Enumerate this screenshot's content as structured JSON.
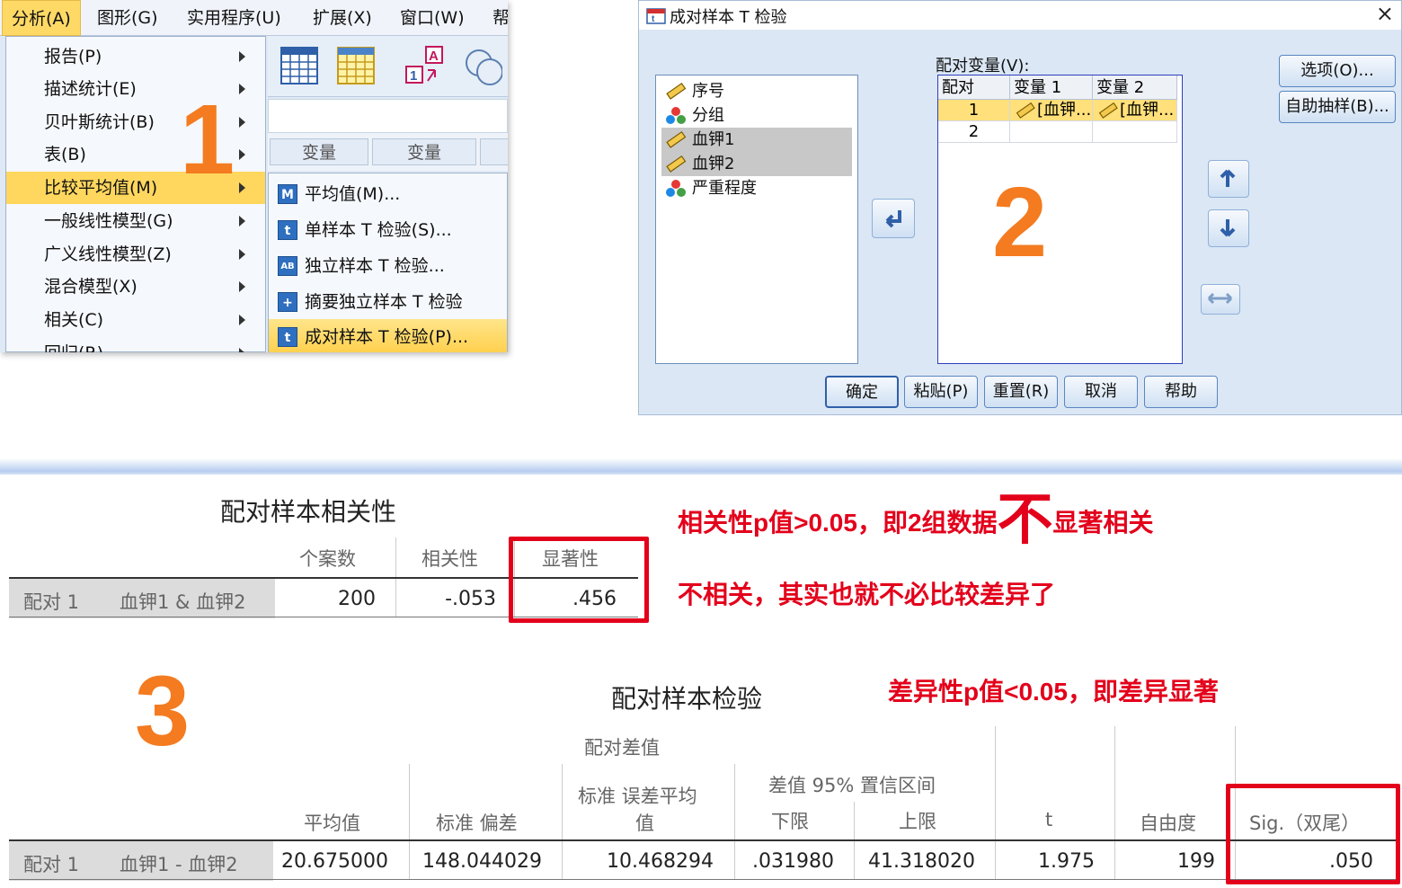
{
  "panel1": {
    "menubar": [
      "分析(A)",
      "图形(G)",
      "实用程序(U)",
      "扩展(X)",
      "窗口(W)",
      "帮"
    ],
    "menu_items": [
      "报告(P)",
      "描述统计(E)",
      "贝叶斯统计(B)",
      "表(B)",
      "比较平均值(M)",
      "一般线性模型(G)",
      "广义线性模型(Z)",
      "混合模型(X)",
      "相关(C)",
      "回归(R)"
    ],
    "var_headers": [
      "变量",
      "变量"
    ],
    "submenu_items": [
      {
        "icon": "M",
        "label": "平均值(M)..."
      },
      {
        "icon": "t",
        "label": "单样本 T 检验(S)..."
      },
      {
        "icon": "AB",
        "label": "独立样本 T 检验..."
      },
      {
        "icon": "+",
        "label": "摘要独立样本 T 检验"
      },
      {
        "icon": "t",
        "label": "成对样本 T 检验(P)..."
      }
    ],
    "step": "1"
  },
  "panel2": {
    "title": "成对样本 T 检验",
    "close": "×",
    "source_vars": [
      "序号",
      "分组",
      "血钾1",
      "血钾2",
      "严重程度"
    ],
    "pair_label": "配对变量(V):",
    "grid_headers": [
      "配对",
      "变量 1",
      "变量 2"
    ],
    "grid_rows": [
      {
        "n": "1",
        "v1": "[血钾...",
        "v2": "[血钾..."
      },
      {
        "n": "2",
        "v1": "",
        "v2": ""
      }
    ],
    "side_buttons": [
      "选项(O)...",
      "自助抽样(B)..."
    ],
    "bottom_buttons": [
      "确定",
      "粘贴(P)",
      "重置(R)",
      "取消",
      "帮助"
    ],
    "step": "2"
  },
  "corr_table": {
    "title": "配对样本相关性",
    "headers": [
      "个案数",
      "相关性",
      "显著性"
    ],
    "row": {
      "pair": "配对 1",
      "label": "血钾1 & 血钾2",
      "n": "200",
      "corr": "-.053",
      "sig": ".456"
    }
  },
  "annotations": {
    "corr_line1_a": "相关性p值>0.05，即2组数据",
    "corr_line1_big": "不",
    "corr_line1_b": "显著相关",
    "corr_line2": "不相关，其实也就不必比较差异了",
    "test_note": "差异性p值<0.05，即差异显著"
  },
  "test_table": {
    "title": "配对样本检验",
    "group_header": "配对差值",
    "ci_header": "差值 95% 置信区间",
    "headers": {
      "mean": "平均值",
      "sd": "标准 偏差",
      "se_a": "标准 误差平均",
      "se_b": "值",
      "lower": "下限",
      "upper": "上限",
      "t": "t",
      "df": "自由度",
      "sig": "Sig.（双尾）"
    },
    "row": {
      "pair": "配对 1",
      "label": "血钾1 - 血钾2",
      "mean": "20.675000",
      "sd": "148.044029",
      "se": "10.468294",
      "lower": ".031980",
      "upper": "41.318020",
      "t": "1.975",
      "df": "199",
      "sig": ".050"
    },
    "step": "3"
  },
  "colors": {
    "accent_orange": "#f47b20",
    "highlight_red": "#e3001b",
    "menu_highlight": "#ffd75e"
  }
}
